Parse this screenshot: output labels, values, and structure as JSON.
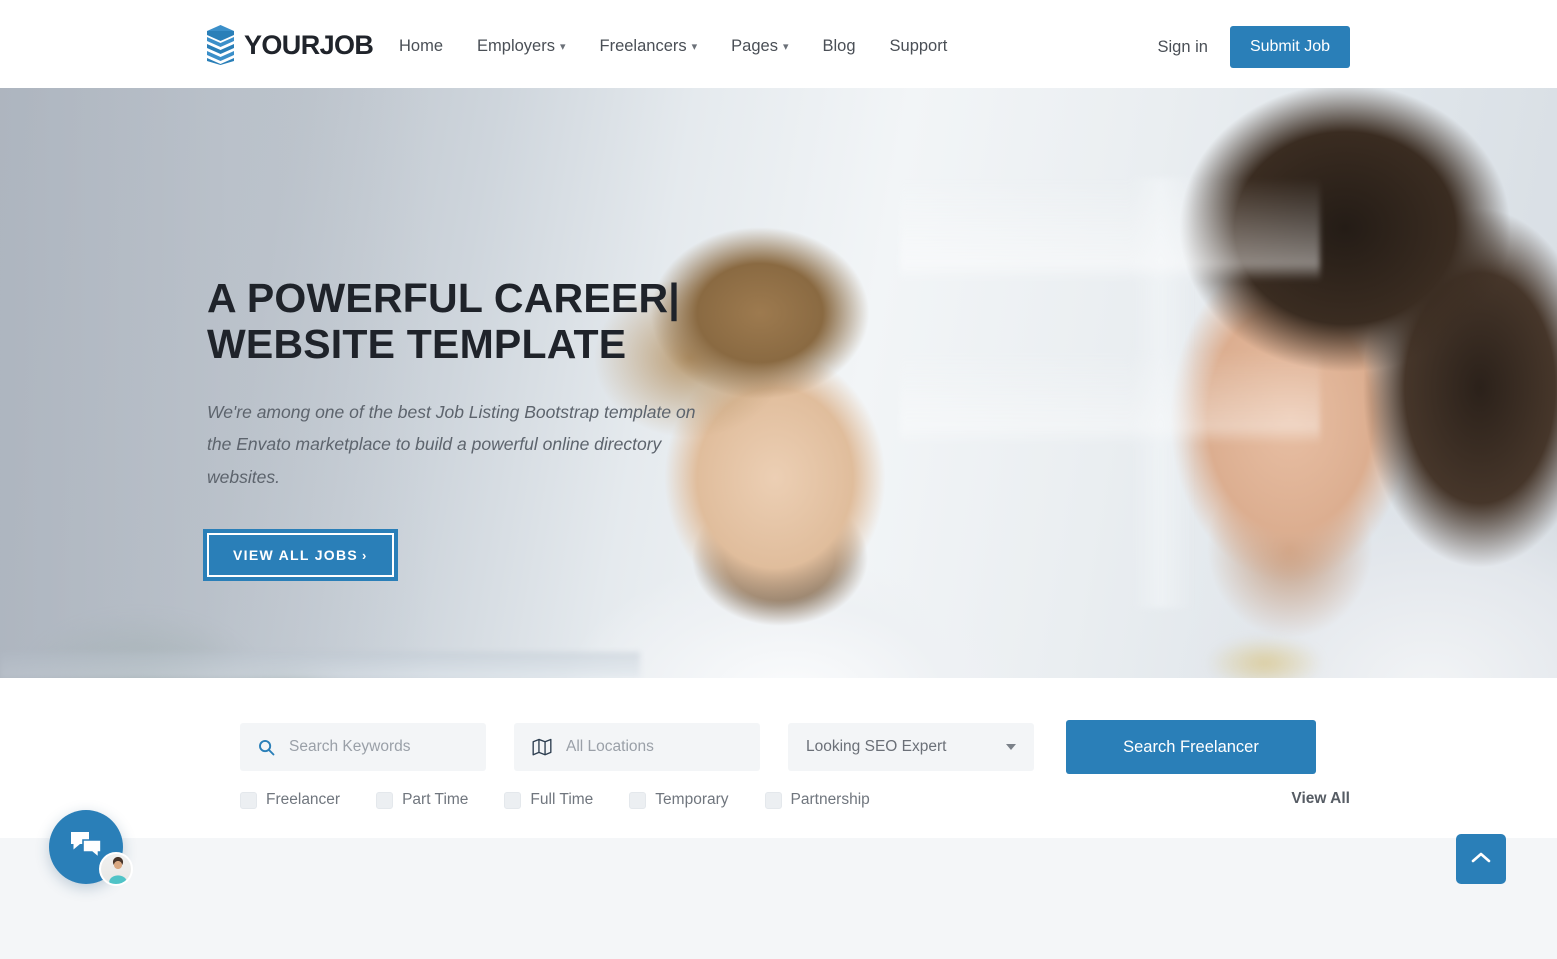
{
  "header": {
    "logo": {
      "text": "YOURJOB",
      "icon": "layers-icon"
    },
    "nav": [
      {
        "label": "Home",
        "has_caret": false
      },
      {
        "label": "Employers",
        "has_caret": true
      },
      {
        "label": "Freelancers",
        "has_caret": true
      },
      {
        "label": "Pages",
        "has_caret": true
      },
      {
        "label": "Blog",
        "has_caret": false
      },
      {
        "label": "Support",
        "has_caret": false
      }
    ],
    "sign_in_label": "Sign in",
    "submit_job_label": "Submit Job"
  },
  "hero": {
    "title_line1": "A POWERFUL CAREER|",
    "title_line2": "WEBSITE TEMPLATE",
    "description": "We're among one of the best Job Listing Bootstrap template on the Envato marketplace to build a powerful online directory websites.",
    "cta_label": "VIEW ALL JOBS",
    "cta_arrow": "›"
  },
  "search": {
    "keywords": {
      "placeholder": "Search Keywords",
      "value": "",
      "icon": "search-icon"
    },
    "location": {
      "placeholder": "All Locations",
      "value": "",
      "icon": "map-icon"
    },
    "category": {
      "selected": "Looking SEO Expert",
      "icon": "chevron-down-icon"
    },
    "submit_label": "Search Freelancer",
    "filters": [
      {
        "label": "Freelancer",
        "checked": false
      },
      {
        "label": "Part Time",
        "checked": false
      },
      {
        "label": "Full Time",
        "checked": false
      },
      {
        "label": "Temporary",
        "checked": false
      },
      {
        "label": "Partnership",
        "checked": false
      }
    ],
    "view_all_label": "View All"
  },
  "widgets": {
    "chat": {
      "icon": "chat-bubbles-icon",
      "avatar": "agent-avatar"
    },
    "scroll_top": {
      "icon": "chevron-up-icon"
    }
  },
  "colors": {
    "accent": "#2a7fb8",
    "text_dark": "#1f232a",
    "text_muted": "#70767e",
    "field_bg": "#f3f5f7",
    "strip_bg": "#f4f6f8"
  }
}
